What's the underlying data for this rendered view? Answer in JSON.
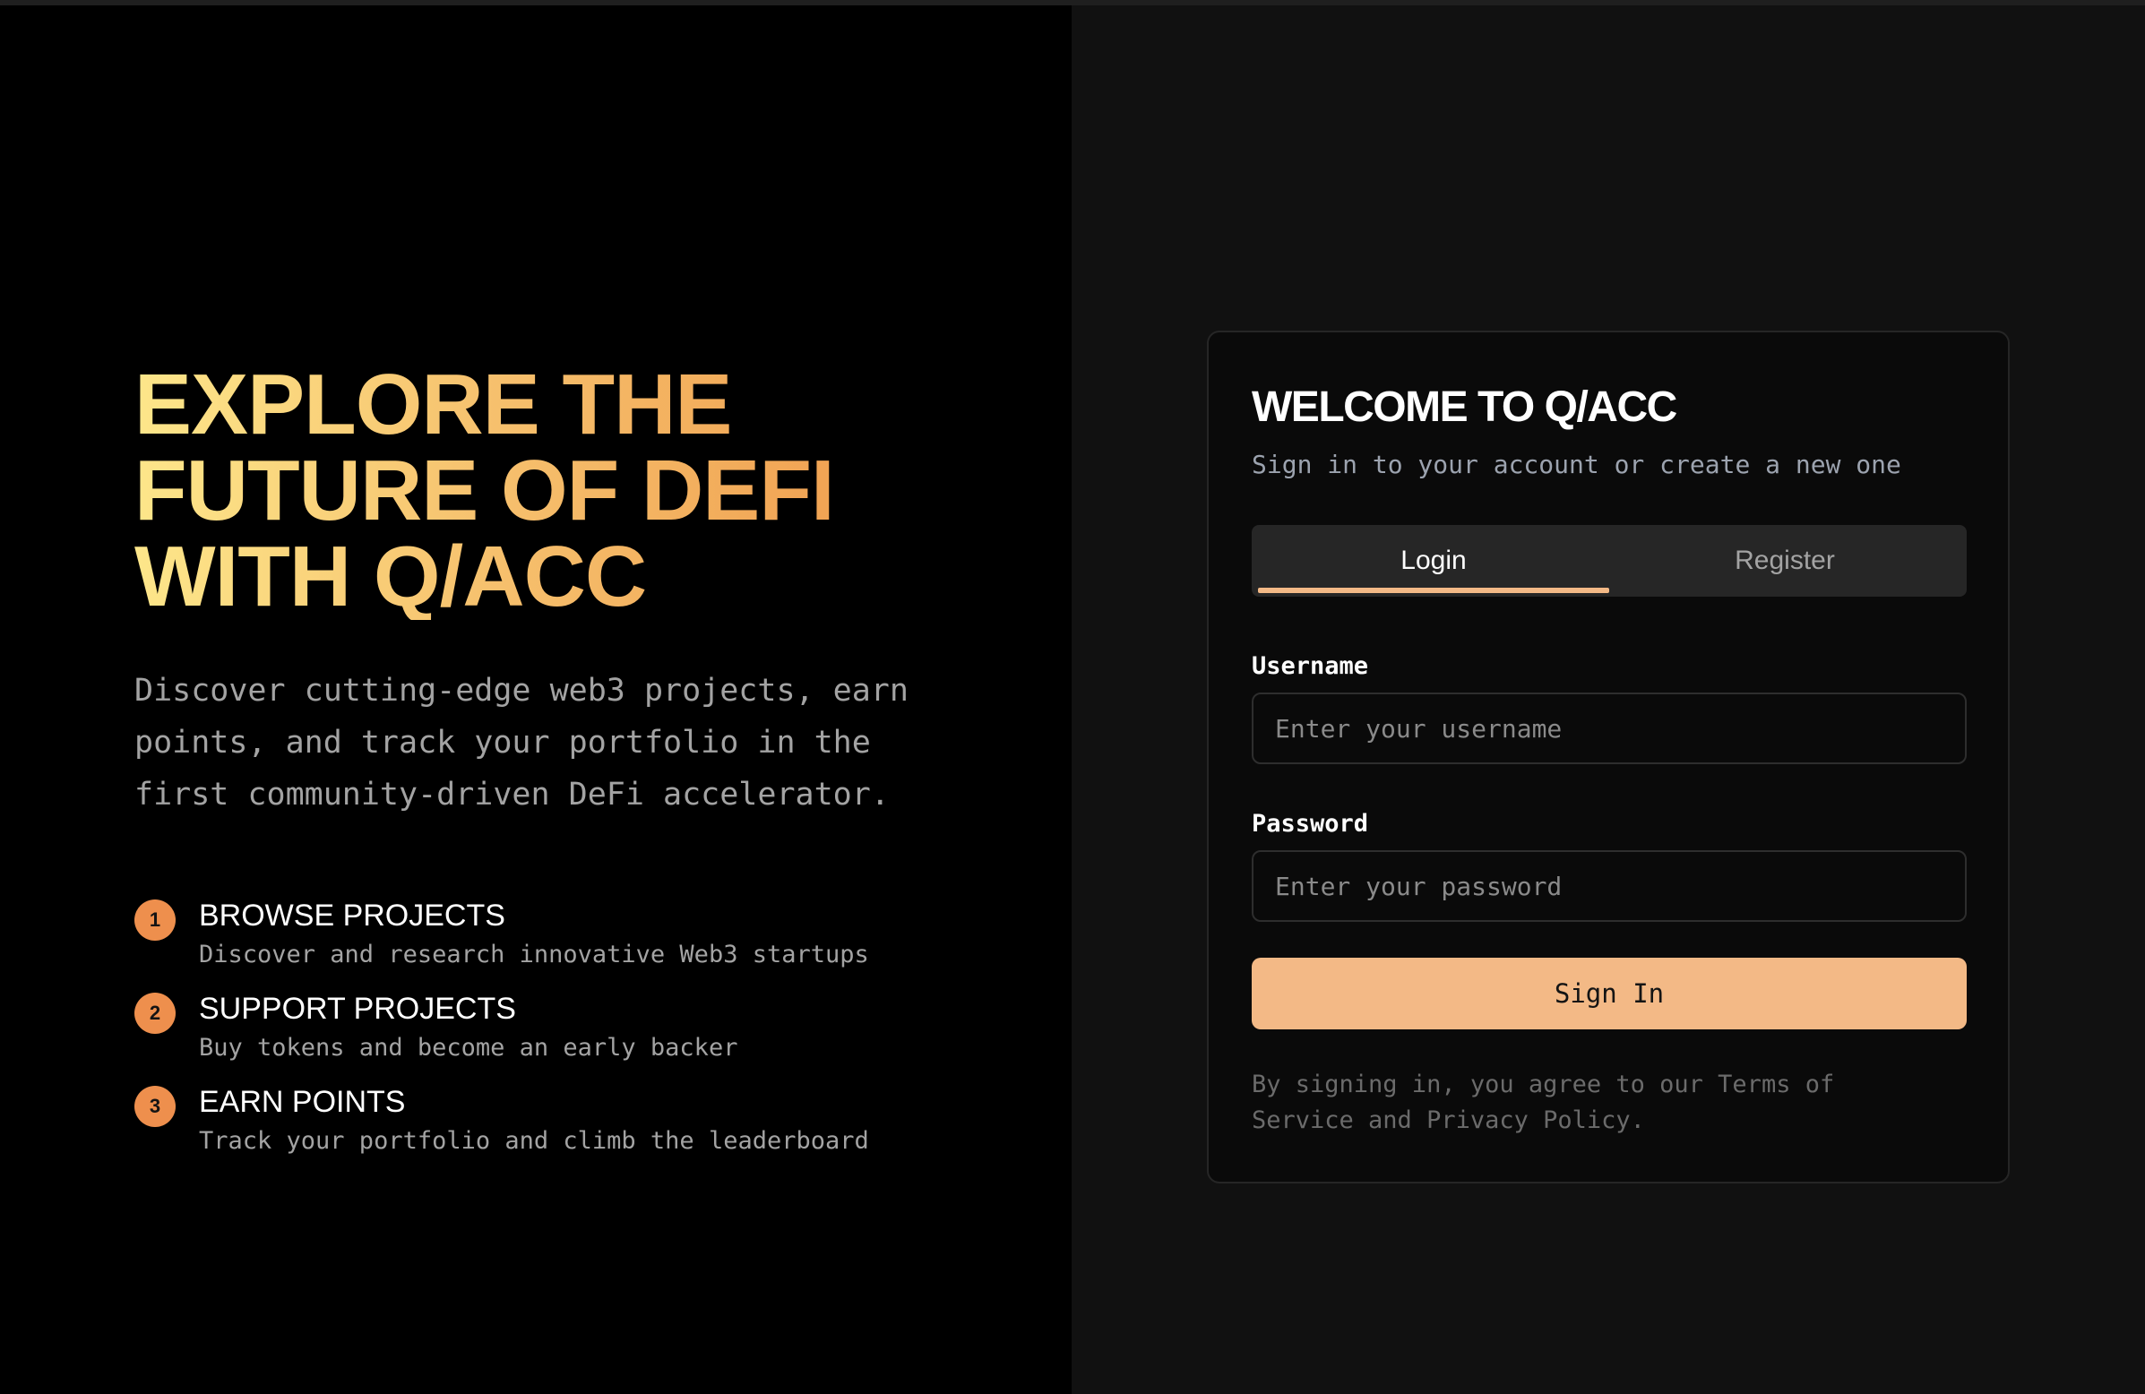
{
  "hero": {
    "title_lines": [
      "EXPLORE THE",
      "FUTURE OF DEFI",
      "WITH Q/ACC"
    ],
    "description": "Discover cutting-edge web3 projects, earn points, and track your portfolio in the first community-driven DeFi accelerator."
  },
  "steps": [
    {
      "number": "1",
      "title": "BROWSE PROJECTS",
      "description": "Discover and research innovative Web3 startups"
    },
    {
      "number": "2",
      "title": "SUPPORT PROJECTS",
      "description": "Buy tokens and become an early backer"
    },
    {
      "number": "3",
      "title": "EARN POINTS",
      "description": "Track your portfolio and climb the leaderboard"
    }
  ],
  "card": {
    "title": "WELCOME TO Q/ACC",
    "subtitle": "Sign in to your account or create a new one",
    "tabs": [
      {
        "label": "Login",
        "active": true
      },
      {
        "label": "Register",
        "active": false
      }
    ],
    "username": {
      "label": "Username",
      "value": "",
      "placeholder": "Enter your username"
    },
    "password": {
      "label": "Password",
      "value": "",
      "placeholder": "Enter your password"
    },
    "submit_label": "Sign In",
    "legal": "By signing in, you agree to our Terms of Service and Privacy Policy."
  },
  "colors": {
    "accent": "#f3b986",
    "step_badge": "#ee8f4d",
    "gradient_start": "#fde68a",
    "gradient_end": "#ef9a4b"
  }
}
